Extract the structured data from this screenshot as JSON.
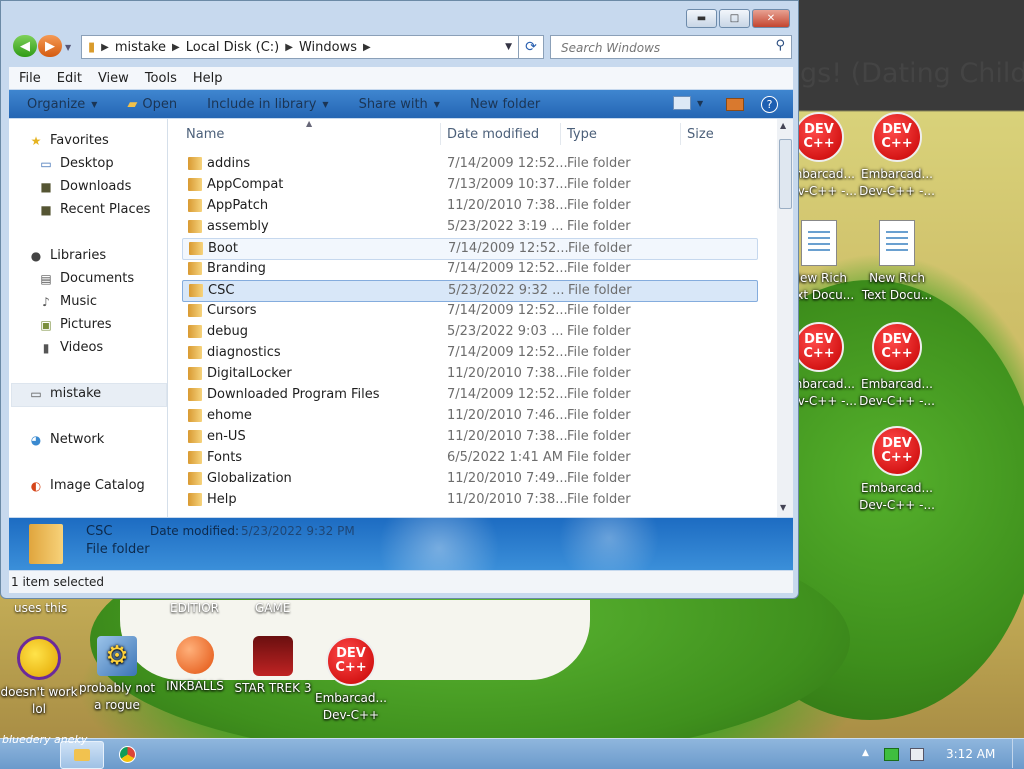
{
  "background": {
    "web_title": "gs! (Dating Childre"
  },
  "desktop_icons": {
    "top_captions": [
      "uses this",
      "EDITIOR",
      "GAME"
    ],
    "right_column": [
      {
        "label": "Embarcad... Dev-C++ -...",
        "type": "devcpp"
      },
      {
        "label": "Embarcad... Dev-C++ -...",
        "type": "devcpp"
      },
      {
        "label": "New Rich Text Docu...",
        "type": "doc"
      },
      {
        "label": "New Rich Text Docu...",
        "type": "doc"
      },
      {
        "label": "Embarcad... Dev-C++ -...",
        "type": "devcpp"
      },
      {
        "label": "Embarcad... Dev-C++ -...",
        "type": "devcpp"
      },
      {
        "label": "Embarcad... Dev-C++ -...",
        "type": "devcpp"
      }
    ],
    "bottom_row": [
      {
        "label": "doesn't work lol",
        "icon": "yahoo-messenger-icon"
      },
      {
        "label": "probably not a rogue",
        "icon": "gears-icon"
      },
      {
        "label": "INKBALLS",
        "icon": "inkball-icon"
      },
      {
        "label": "STAR TREK 3",
        "icon": "star-trek-icon"
      },
      {
        "label": "Embarcad... Dev-C++",
        "icon": "devcpp-icon"
      }
    ]
  },
  "window": {
    "controls": {
      "minimize": "▬",
      "maximize": "□",
      "close": "✕"
    },
    "address": {
      "crumbs": [
        "mistake",
        "Local Disk (C:)",
        "Windows"
      ]
    },
    "search": {
      "placeholder": "Search Windows"
    },
    "menubar": [
      "File",
      "Edit",
      "View",
      "Tools",
      "Help"
    ],
    "commands": {
      "organize": "Organize",
      "open": "Open",
      "include": "Include in library",
      "share": "Share with",
      "new_folder": "New folder"
    },
    "nav_pane": {
      "favorites": "Favorites",
      "desktop": "Desktop",
      "downloads": "Downloads",
      "recent": "Recent Places",
      "libraries": "Libraries",
      "documents": "Documents",
      "music": "Music",
      "pictures": "Pictures",
      "videos": "Videos",
      "mistake": "mistake",
      "network": "Network",
      "image_catalog": "Image Catalog"
    },
    "columns": {
      "name": "Name",
      "date": "Date modified",
      "type": "Type",
      "size": "Size"
    },
    "files": [
      {
        "name": "addins",
        "date": "7/14/2009 12:52...",
        "type": "File folder"
      },
      {
        "name": "AppCompat",
        "date": "7/13/2009 10:37...",
        "type": "File folder"
      },
      {
        "name": "AppPatch",
        "date": "11/20/2010 7:38...",
        "type": "File folder"
      },
      {
        "name": "assembly",
        "date": "5/23/2022 3:19 ...",
        "type": "File folder"
      },
      {
        "name": "Boot",
        "date": "7/14/2009 12:52...",
        "type": "File folder"
      },
      {
        "name": "Branding",
        "date": "7/14/2009 12:52...",
        "type": "File folder"
      },
      {
        "name": "CSC",
        "date": "5/23/2022 9:32 ...",
        "type": "File folder"
      },
      {
        "name": "Cursors",
        "date": "7/14/2009 12:52...",
        "type": "File folder"
      },
      {
        "name": "debug",
        "date": "5/23/2022 9:03 ...",
        "type": "File folder"
      },
      {
        "name": "diagnostics",
        "date": "7/14/2009 12:52...",
        "type": "File folder"
      },
      {
        "name": "DigitalLocker",
        "date": "11/20/2010 7:38...",
        "type": "File folder"
      },
      {
        "name": "Downloaded Program Files",
        "date": "7/14/2009 12:52...",
        "type": "File folder"
      },
      {
        "name": "ehome",
        "date": "11/20/2010 7:46...",
        "type": "File folder"
      },
      {
        "name": "en-US",
        "date": "11/20/2010 7:38...",
        "type": "File folder"
      },
      {
        "name": "Fonts",
        "date": "6/5/2022 1:41 AM",
        "type": "File folder"
      },
      {
        "name": "Globalization",
        "date": "11/20/2010 7:49...",
        "type": "File folder"
      },
      {
        "name": "Help",
        "date": "11/20/2010 7:38...",
        "type": "File folder"
      }
    ],
    "details": {
      "name": "CSC",
      "kind": "File folder",
      "date_label": "Date modified:",
      "date_value": "5/23/2022 9:32 PM"
    },
    "status": "1 item selected"
  },
  "taskbar": {
    "signature": "bluedery aneky",
    "clock": "3:12 AM"
  }
}
